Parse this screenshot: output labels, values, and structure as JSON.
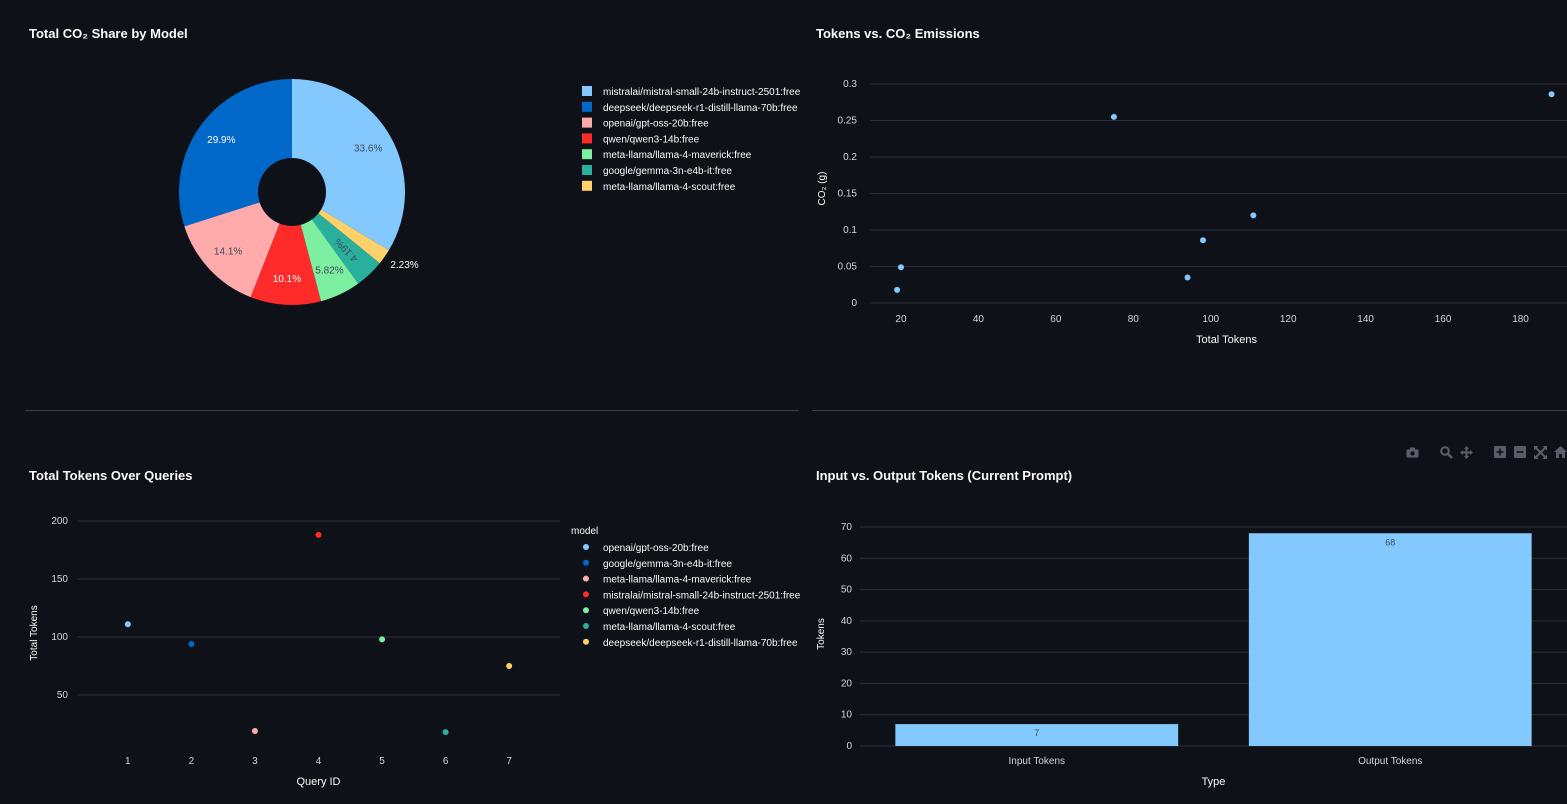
{
  "titles": {
    "pie": "Total CO₂ Share by Model",
    "scatter": "Tokens vs. CO₂ Emissions",
    "queries": "Total Tokens Over Queries",
    "bars": "Input vs. Output Tokens (Current Prompt)"
  },
  "toolbar": {
    "icons": [
      "camera-icon",
      "zoom-icon",
      "pan-icon",
      "zoom-in-icon",
      "zoom-out-icon",
      "autoscale-icon",
      "home-icon"
    ]
  },
  "chart_data": [
    {
      "type": "pie",
      "title": "Total CO₂ Share by Model",
      "hole": true,
      "slices": [
        {
          "label": "mistralai/mistral-small-24b-instruct-2501:free",
          "value": 33.6,
          "text": "33.6%",
          "color": "#83c9ff"
        },
        {
          "label": "meta-llama/llama-4-scout:free",
          "value": 2.23,
          "text": "2.23%",
          "color": "#ffd16a"
        },
        {
          "label": "google/gemma-3n-e4b-it:free",
          "value": 4.19,
          "text": "4.19%",
          "color": "#29b09d"
        },
        {
          "label": "meta-llama/llama-4-maverick:free",
          "value": 5.82,
          "text": "5.82%",
          "color": "#7defa1"
        },
        {
          "label": "qwen/qwen3-14b:free",
          "value": 10.1,
          "text": "10.1%",
          "color": "#ff2b2b"
        },
        {
          "label": "openai/gpt-oss-20b:free",
          "value": 14.1,
          "text": "14.1%",
          "color": "#ffabab"
        },
        {
          "label": "deepseek/deepseek-r1-distill-llama-70b:free",
          "value": 29.9,
          "text": "29.9%",
          "color": "#0068c9"
        }
      ],
      "legend": [
        {
          "label": "mistralai/mistral-small-24b-instruct-2501:free",
          "color": "#83c9ff"
        },
        {
          "label": "deepseek/deepseek-r1-distill-llama-70b:free",
          "color": "#0068c9"
        },
        {
          "label": "openai/gpt-oss-20b:free",
          "color": "#ffabab"
        },
        {
          "label": "qwen/qwen3-14b:free",
          "color": "#ff2b2b"
        },
        {
          "label": "meta-llama/llama-4-maverick:free",
          "color": "#7defa1"
        },
        {
          "label": "google/gemma-3n-e4b-it:free",
          "color": "#29b09d"
        },
        {
          "label": "meta-llama/llama-4-scout:free",
          "color": "#ffd16a"
        }
      ],
      "legend_placement": "right"
    },
    {
      "type": "scatter",
      "title": "Tokens vs. CO₂ Emissions",
      "xlabel": "Total Tokens",
      "ylabel": "CO₂ (g)",
      "xlim": [
        12,
        192
      ],
      "ylim": [
        0,
        0.3
      ],
      "xticks": [
        20,
        40,
        60,
        80,
        100,
        120,
        140,
        160,
        180
      ],
      "yticks": [
        0,
        0.05,
        0.1,
        0.15,
        0.2,
        0.25,
        0.3
      ],
      "ytick_labels": [
        "0",
        "0.05",
        "0.1",
        "0.15",
        "0.2",
        "0.25",
        "0.3"
      ],
      "grid": true,
      "color": "#83c9ff",
      "points": [
        {
          "x": 19,
          "y": 0.018
        },
        {
          "x": 20,
          "y": 0.049
        },
        {
          "x": 75,
          "y": 0.255
        },
        {
          "x": 94,
          "y": 0.035
        },
        {
          "x": 98,
          "y": 0.086
        },
        {
          "x": 111,
          "y": 0.12
        },
        {
          "x": 188,
          "y": 0.286
        }
      ]
    },
    {
      "type": "scatter",
      "title": "Total Tokens Over Queries",
      "xlabel": "Query ID",
      "ylabel": "Total Tokens",
      "xlim": [
        0.2,
        7.8
      ],
      "ylim": [
        0,
        212
      ],
      "xticks": [
        1,
        2,
        3,
        4,
        5,
        6,
        7
      ],
      "yticks": [
        50,
        100,
        150,
        200
      ],
      "grid": true,
      "legend_title": "model",
      "legend_placement": "right",
      "series": [
        {
          "name": "openai/gpt-oss-20b:free",
          "color": "#83c9ff",
          "points": [
            {
              "x": 1,
              "y": 111
            }
          ]
        },
        {
          "name": "google/gemma-3n-e4b-it:free",
          "color": "#0068c9",
          "points": [
            {
              "x": 2,
              "y": 94
            }
          ]
        },
        {
          "name": "meta-llama/llama-4-maverick:free",
          "color": "#ffabab",
          "points": [
            {
              "x": 3,
              "y": 19
            }
          ]
        },
        {
          "name": "mistralai/mistral-small-24b-instruct-2501:free",
          "color": "#ff2b2b",
          "points": [
            {
              "x": 4,
              "y": 188
            }
          ]
        },
        {
          "name": "qwen/qwen3-14b:free",
          "color": "#7defa1",
          "points": [
            {
              "x": 5,
              "y": 98
            }
          ]
        },
        {
          "name": "meta-llama/llama-4-scout:free",
          "color": "#29b09d",
          "points": [
            {
              "x": 6,
              "y": 18
            }
          ]
        },
        {
          "name": "deepseek/deepseek-r1-distill-llama-70b:free",
          "color": "#ffd16a",
          "points": [
            {
              "x": 7,
              "y": 75
            }
          ]
        }
      ]
    },
    {
      "type": "bar",
      "title": "Input vs. Output Tokens (Current Prompt)",
      "xlabel": "Type",
      "ylabel": "Tokens",
      "categories": [
        "Input Tokens",
        "Output Tokens"
      ],
      "values": [
        7,
        68
      ],
      "value_labels": [
        "7",
        "68"
      ],
      "ylim": [
        0,
        73
      ],
      "yticks": [
        0,
        10,
        20,
        30,
        40,
        50,
        60,
        70
      ],
      "grid": true,
      "color": "#83c9ff"
    }
  ]
}
